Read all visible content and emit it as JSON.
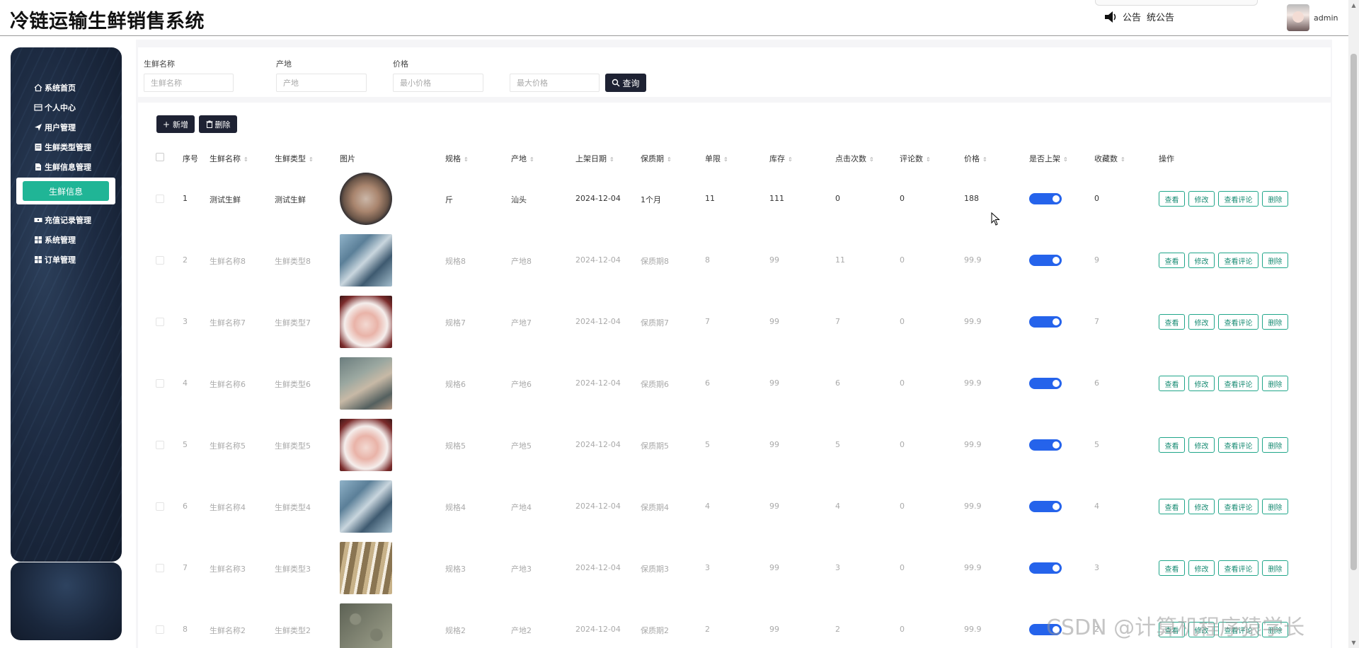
{
  "app": {
    "title": "冷链运输生鲜销售系统"
  },
  "header": {
    "notice_label": "公告",
    "notice_text": "统公告",
    "username": "admin"
  },
  "sidebar": {
    "items": [
      {
        "label": "系统首页",
        "icon": "home-icon"
      },
      {
        "label": "个人中心",
        "icon": "card-icon"
      },
      {
        "label": "用户管理",
        "icon": "send-icon"
      },
      {
        "label": "生鲜类型管理",
        "icon": "doc-icon"
      },
      {
        "label": "生鲜信息管理",
        "icon": "file-icon"
      },
      {
        "label": "生鲜信息",
        "icon": "",
        "active": true
      },
      {
        "label": "充值记录管理",
        "icon": "ticket-icon"
      },
      {
        "label": "系统管理",
        "icon": "grid-icon"
      },
      {
        "label": "订单管理",
        "icon": "grid-icon"
      }
    ]
  },
  "filters": {
    "name_label": "生鲜名称",
    "name_placeholder": "生鲜名称",
    "origin_label": "产地",
    "origin_placeholder": "产地",
    "price_label": "价格",
    "min_price_placeholder": "最小价格",
    "max_price_placeholder": "最大价格",
    "search_button": "查询"
  },
  "toolbar": {
    "add_button": "新增",
    "delete_button": "删除"
  },
  "table": {
    "columns": [
      "序号",
      "生鲜名称",
      "生鲜类型",
      "图片",
      "规格",
      "产地",
      "上架日期",
      "保质期",
      "单限",
      "库存",
      "点击次数",
      "评论数",
      "价格",
      "是否上架",
      "收藏数",
      "操作"
    ],
    "rows": [
      {
        "index": "1",
        "name": "测试生鲜",
        "type": "测试生鲜",
        "image": "shellfish-tray",
        "spec": "斤",
        "origin": "汕头",
        "date": "2024-12-04",
        "shelf_life": "1个月",
        "limit": "11",
        "stock": "111",
        "clicks": "0",
        "comments": "0",
        "price": "188",
        "listed": true,
        "favorites": "0"
      },
      {
        "index": "2",
        "name": "生鲜名称8",
        "type": "生鲜类型8",
        "image": "fish-on-ice",
        "spec": "规格8",
        "origin": "产地8",
        "date": "2024-12-04",
        "shelf_life": "保质期8",
        "limit": "8",
        "stock": "99",
        "clicks": "11",
        "comments": "0",
        "price": "99.9",
        "listed": true,
        "favorites": "9"
      },
      {
        "index": "3",
        "name": "生鲜名称7",
        "type": "生鲜类型7",
        "image": "sashimi-plate",
        "spec": "规格7",
        "origin": "产地7",
        "date": "2024-12-04",
        "shelf_life": "保质期7",
        "limit": "7",
        "stock": "99",
        "clicks": "7",
        "comments": "0",
        "price": "99.9",
        "listed": true,
        "favorites": "7"
      },
      {
        "index": "4",
        "name": "生鲜名称6",
        "type": "生鲜类型6",
        "image": "whole-fish",
        "spec": "规格6",
        "origin": "产地6",
        "date": "2024-12-04",
        "shelf_life": "保质期6",
        "limit": "6",
        "stock": "99",
        "clicks": "6",
        "comments": "0",
        "price": "99.9",
        "listed": true,
        "favorites": "6"
      },
      {
        "index": "5",
        "name": "生鲜名称5",
        "type": "生鲜类型5",
        "image": "sashimi-plate",
        "spec": "规格5",
        "origin": "产地5",
        "date": "2024-12-04",
        "shelf_life": "保质期5",
        "limit": "5",
        "stock": "99",
        "clicks": "5",
        "comments": "0",
        "price": "99.9",
        "listed": true,
        "favorites": "5"
      },
      {
        "index": "6",
        "name": "生鲜名称4",
        "type": "生鲜类型4",
        "image": "fish-on-ice",
        "spec": "规格4",
        "origin": "产地4",
        "date": "2024-12-04",
        "shelf_life": "保质期4",
        "limit": "4",
        "stock": "99",
        "clicks": "4",
        "comments": "0",
        "price": "99.9",
        "listed": true,
        "favorites": "4"
      },
      {
        "index": "7",
        "name": "生鲜名称3",
        "type": "生鲜类型3",
        "image": "razor-clams",
        "spec": "规格3",
        "origin": "产地3",
        "date": "2024-12-04",
        "shelf_life": "保质期3",
        "limit": "3",
        "stock": "99",
        "clicks": "3",
        "comments": "0",
        "price": "99.9",
        "listed": true,
        "favorites": "3"
      },
      {
        "index": "8",
        "name": "生鲜名称2",
        "type": "生鲜类型2",
        "image": "snails",
        "spec": "规格2",
        "origin": "产地2",
        "date": "2024-12-04",
        "shelf_life": "保质期2",
        "limit": "2",
        "stock": "99",
        "clicks": "2",
        "comments": "0",
        "price": "99.9",
        "listed": true,
        "favorites": "2"
      }
    ],
    "actions": [
      "查看",
      "修改",
      "查看评论",
      "删除"
    ]
  },
  "watermark": "CSDN @计算机程序猿学长",
  "colors": {
    "accent": "#20b596",
    "dark_button": "#1e2233",
    "toggle_on": "#2563eb",
    "action_border": "#20a68a"
  }
}
